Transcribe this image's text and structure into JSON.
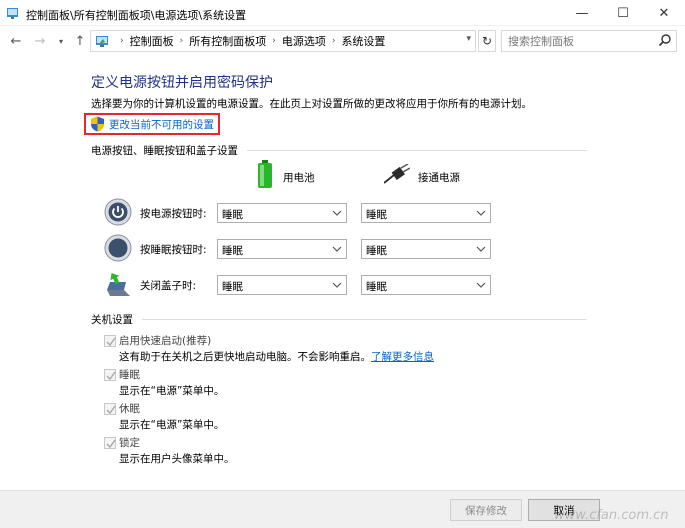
{
  "window": {
    "title": "控制面板\\所有控制面板项\\电源选项\\系统设置",
    "min_glyph": "—",
    "max_glyph": "☐",
    "close_glyph": "✕"
  },
  "nav": {
    "back_glyph": "←",
    "forward_glyph": "→",
    "recent_glyph": "▾",
    "up_glyph": "↑",
    "refresh_glyph": "↻",
    "dropdown_glyph": "▾",
    "separator_glyph": "›",
    "breadcrumb": [
      "控制面板",
      "所有控制面板项",
      "电源选项",
      "系统设置"
    ],
    "search_placeholder": "搜索控制面板"
  },
  "page": {
    "title": "定义电源按钮并启用密码保护",
    "description": "选择要为你的计算机设置的电源设置。在此页上对设置所做的更改将应用于你所有的电源计划。",
    "change_link": "更改当前不可用的设置"
  },
  "power_section": {
    "title": "电源按钮、睡眠按钮和盖子设置",
    "columns": {
      "battery": "用电池",
      "plugged": "接通电源"
    },
    "rows": [
      {
        "label": "按电源按钮时:",
        "battery": "睡眠",
        "plugged": "睡眠",
        "icon": "power-button-icon"
      },
      {
        "label": "按睡眠按钮时:",
        "battery": "睡眠",
        "plugged": "睡眠",
        "icon": "sleep-button-icon"
      },
      {
        "label": "关闭盖子时:",
        "battery": "睡眠",
        "plugged": "睡眠",
        "icon": "laptop-lid-icon"
      }
    ]
  },
  "shutdown_section": {
    "title": "关机设置",
    "items": [
      {
        "label": "启用快速启动(推荐)",
        "desc": "这有助于在关机之后更快地启动电脑。不会影响重启。",
        "link": "了解更多信息",
        "checked": true
      },
      {
        "label": "睡眠",
        "desc": "显示在“电源”菜单中。",
        "checked": true
      },
      {
        "label": "休眠",
        "desc": "显示在“电源”菜单中。",
        "checked": true
      },
      {
        "label": "锁定",
        "desc": "显示在用户头像菜单中。",
        "checked": true
      }
    ]
  },
  "footer": {
    "save": "保存修改",
    "cancel": "取消"
  },
  "watermark": "www.cfan.com.cn",
  "colors": {
    "title_blue": "#1e3287",
    "link_blue": "#0066cc",
    "highlight_red": "#e8262b"
  }
}
